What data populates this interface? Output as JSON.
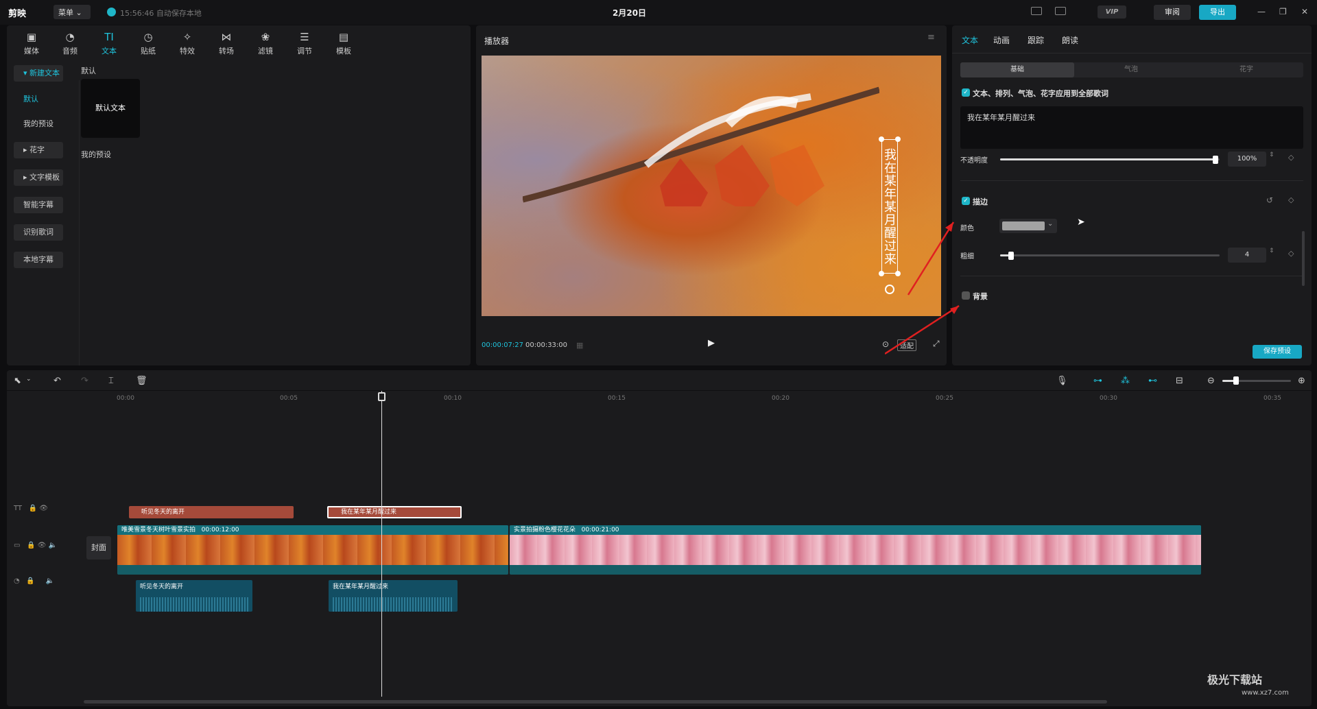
{
  "titlebar": {
    "app_name": "剪映",
    "menu_label": "菜单",
    "save_status": "15:56:46 自动保存本地",
    "title": "2月20日",
    "vip_label": "VIP",
    "review_label": "审阅",
    "export_label": "导出"
  },
  "media_toolbar": [
    {
      "label": "媒体",
      "icon": "media-icon"
    },
    {
      "label": "音频",
      "icon": "audio-icon"
    },
    {
      "label": "文本",
      "icon": "text-icon",
      "active": true
    },
    {
      "label": "贴纸",
      "icon": "sticker-icon"
    },
    {
      "label": "特效",
      "icon": "effects-icon"
    },
    {
      "label": "转场",
      "icon": "transition-icon"
    },
    {
      "label": "滤镜",
      "icon": "filter-icon"
    },
    {
      "label": "调节",
      "icon": "adjust-icon"
    },
    {
      "label": "模板",
      "icon": "template-icon"
    }
  ],
  "text_sidebar": {
    "new_text": "新建文本",
    "default": "默认",
    "my_presets": "我的预设",
    "fancy_text": "花字",
    "text_template": "文字模板",
    "smart_subtitle": "智能字幕",
    "lyric_recognition": "识别歌词",
    "local_subtitle": "本地字幕"
  },
  "text_library": {
    "section_default": "默认",
    "default_tile": "默认文本",
    "section_presets": "我的预设"
  },
  "player": {
    "title": "播放器",
    "overlay_text": "我在某年某月醒过来",
    "current_time": "00:00:07:27",
    "total_time": "00:00:33:00",
    "ratio_label": "适配"
  },
  "inspector": {
    "tabs": [
      "文本",
      "动画",
      "跟踪",
      "朗读"
    ],
    "segments": [
      "基础",
      "气泡",
      "花字"
    ],
    "apply_all_label": "文本、排列、气泡、花字应用到全部歌词",
    "text_value": "我在某年某月醒过来",
    "opacity_label": "不透明度",
    "opacity_value": "100%",
    "stroke_label": "描边",
    "color_label": "颜色",
    "color_value": "#a3a3a3",
    "thickness_label": "粗细",
    "thickness_value": "4",
    "background_label": "背景",
    "save_preset_label": "保存预设"
  },
  "timeline": {
    "ruler_ticks": [
      "00:00",
      "00:05",
      "00:10",
      "00:15",
      "00:20",
      "00:25",
      "00:30",
      "00:35"
    ],
    "cover_label": "封面",
    "text_clips": [
      "听见冬天的离开",
      "我在某年某月醒过来"
    ],
    "video_clips": [
      {
        "name": "唯美雪景冬天树叶雪景实拍",
        "duration": "00:00:12:00"
      },
      {
        "name": "实景拍摄粉色樱花花朵",
        "duration": "00:00:21:00"
      }
    ],
    "audio_clips": [
      "听见冬天的离开",
      "我在某年某月醒过来"
    ]
  },
  "watermark": {
    "text": "极光下载站",
    "url": "www.xz7.com"
  }
}
